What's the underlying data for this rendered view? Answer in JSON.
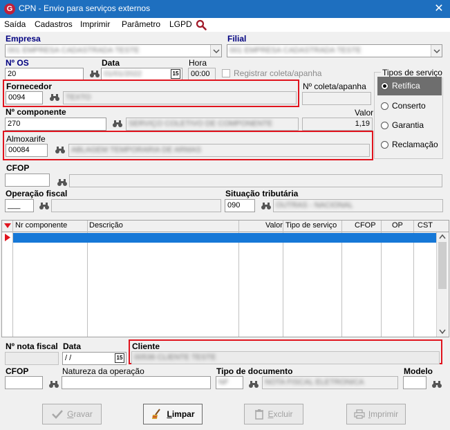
{
  "window": {
    "title": "CPN - Envio para serviços externos",
    "app_icon_letter": "G",
    "close_glyph": "✕"
  },
  "menu": {
    "items": [
      "Saída",
      "Cadastros",
      "Imprimir",
      "Parâmetro",
      "LGPD"
    ]
  },
  "empresa": {
    "label": "Empresa",
    "value": "001 EMPRESA CADASTRADA TESTE"
  },
  "filial": {
    "label": "Filial",
    "value": "001 EMPRESA CADASTRADA TESTE"
  },
  "os": {
    "label": "Nº  OS",
    "value": "20"
  },
  "data": {
    "label": "Data",
    "value": "01/01/2022",
    "cal": "15"
  },
  "hora": {
    "label": "Hora",
    "value": "00:00"
  },
  "registrar": {
    "label": "Registrar coleta/apanha"
  },
  "tipos_servico": {
    "label": "Tipos de serviço",
    "options": [
      "Retífica",
      "Conserto",
      "Garantia",
      "Reclamação"
    ],
    "selected": 0
  },
  "fornecedor": {
    "label": "Fornecedor",
    "code": "0094",
    "name": "TEXTO"
  },
  "coleta": {
    "label": "Nº coleta/apanha"
  },
  "componente": {
    "label": "Nº  componente",
    "code": "270",
    "desc": "SERVIÇO COLETIVO DE COMPONENTE",
    "valor_label": "Valor",
    "valor": "1,19"
  },
  "almoxarife": {
    "label": "Almoxarife",
    "code": "00084",
    "name": "ABLAGEM TEMPORARIA DE ARMAS"
  },
  "cfop_top": {
    "label": "CFOP"
  },
  "operacao": {
    "label": "Operação fiscal",
    "value": "___"
  },
  "situacao": {
    "label": "Situação tributária",
    "code": "090",
    "desc": "OUTRAS - NACIONAL"
  },
  "grid": {
    "columns": [
      "Nr componente",
      "Descrição",
      "Valor",
      "Tipo de serviço",
      "CFOP",
      "OP",
      "CST"
    ]
  },
  "nota": {
    "label": "Nº nota fiscal",
    "data_label": "Data",
    "data_value": " / /",
    "cal": "15"
  },
  "cliente": {
    "label": "Cliente",
    "value": "00536 CLIENTE TESTE"
  },
  "cfop_bottom": {
    "label": "CFOP"
  },
  "natureza": {
    "label": "Natureza da operação"
  },
  "tipo_doc": {
    "label": "Tipo de documento",
    "code": "NF",
    "desc": "NOTA FISCAL ELETRONICA"
  },
  "modelo": {
    "label": "Modelo"
  },
  "buttons": {
    "gravar_u": "G",
    "gravar_rest": "ravar",
    "limpar_u": "L",
    "limpar_rest": "impar",
    "excluir_u": "E",
    "excluir_rest": "xcluir",
    "imprimir_u": "I",
    "imprimir_rest": "mprimir"
  },
  "colors": {
    "titlebar": "#1e6fbf",
    "highlight": "#e0141e",
    "selection": "#1678d7",
    "header_blue": "#000080"
  }
}
